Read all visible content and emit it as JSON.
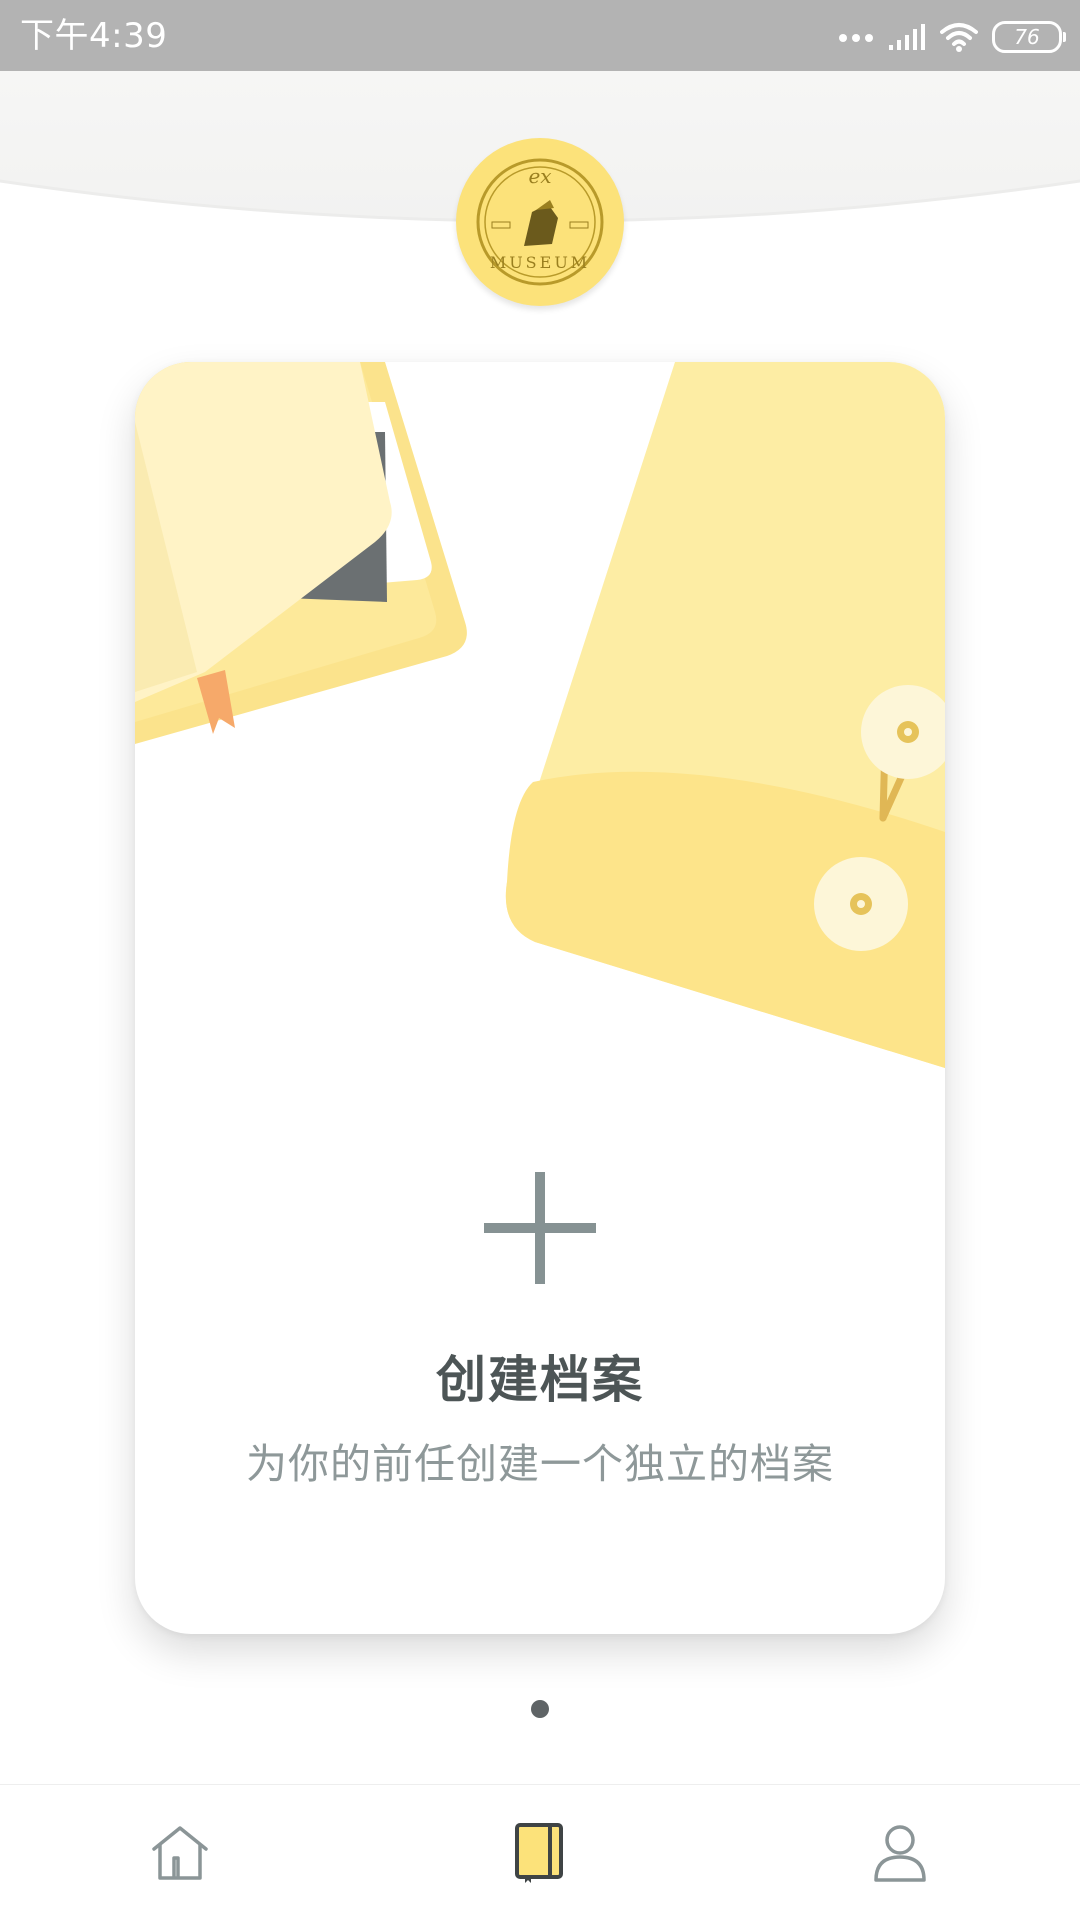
{
  "status_bar": {
    "time": "下午4:39",
    "battery": "76",
    "icons": [
      "more-dots-icon",
      "signal-icon",
      "wifi-icon",
      "battery-icon"
    ]
  },
  "header": {
    "logo": {
      "icon": "ex-museum-logo",
      "text_top": "ex",
      "text_bottom": "MUSEUM",
      "color": "#fce27a"
    }
  },
  "card": {
    "title": "创建档案",
    "subtitle": "为你的前任创建一个独立的档案",
    "icon": "plus-icon",
    "accent_color": "#fde99a"
  },
  "pager": {
    "count": 1,
    "active": 1
  },
  "bottom_nav": {
    "items": [
      {
        "icon": "home-icon",
        "active": false
      },
      {
        "icon": "archive-book-icon",
        "active": true
      },
      {
        "icon": "profile-icon",
        "active": false
      }
    ],
    "active_color": "#fce27a"
  }
}
